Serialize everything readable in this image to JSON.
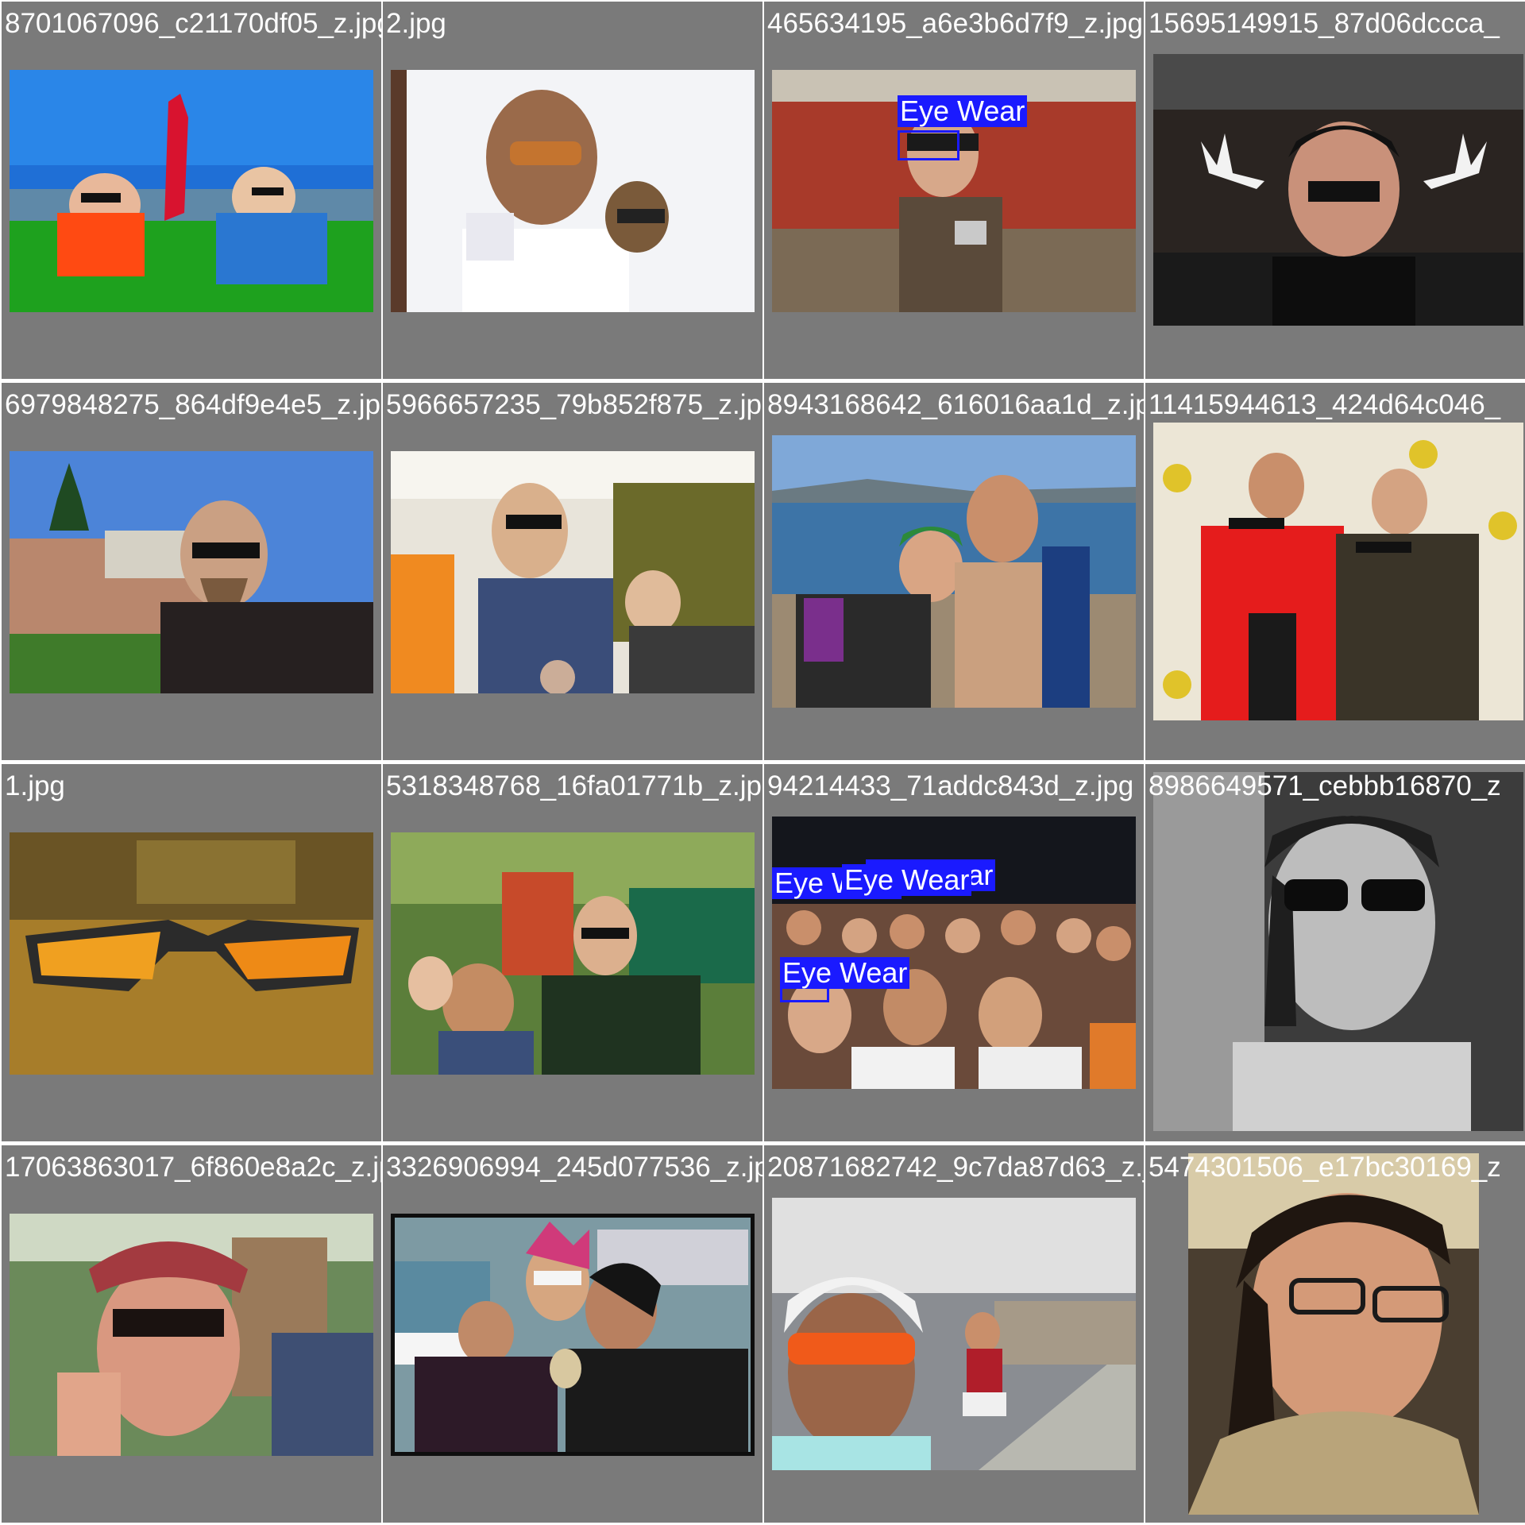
{
  "gallery": {
    "label_color": "#1a1aff",
    "cells": [
      {
        "filename": "8701067096_c21170df05_z.jpg",
        "detections": []
      },
      {
        "filename": "2.jpg",
        "detections": []
      },
      {
        "filename": "465634195_a6e3b6d7f9_z.jpg",
        "detections": [
          {
            "label": "Eye Wear"
          }
        ]
      },
      {
        "filename": "15695149915_87d06dccca_",
        "detections": []
      },
      {
        "filename": "6979848275_864df9e4e5_z.jpg",
        "detections": []
      },
      {
        "filename": "5966657235_79b852f875_z.jpg",
        "detections": []
      },
      {
        "filename": "8943168642_616016aa1d_z.jpg",
        "detections": []
      },
      {
        "filename": "11415944613_424d64c046_",
        "detections": []
      },
      {
        "filename": "1.jpg",
        "detections": []
      },
      {
        "filename": "5318348768_16fa01771b_z.jpg",
        "detections": []
      },
      {
        "filename": "94214433_71addc843d_z.jpg",
        "detections": [
          {
            "label": "Eye Wear"
          },
          {
            "label": "Eye Wear"
          },
          {
            "label": "Eye Wear"
          },
          {
            "label": "Eye Wear"
          }
        ]
      },
      {
        "filename": "8986649571_cebbb16870_z",
        "detections": []
      },
      {
        "filename": "17063863017_6f860e8a2c_z.jpg",
        "detections": []
      },
      {
        "filename": "3326906994_245d077536_z.jpg",
        "detections": []
      },
      {
        "filename": "20871682742_9c7da87d63_z.jpg",
        "detections": []
      },
      {
        "filename": "5474301506_e17bc30169_z",
        "detections": []
      }
    ]
  }
}
